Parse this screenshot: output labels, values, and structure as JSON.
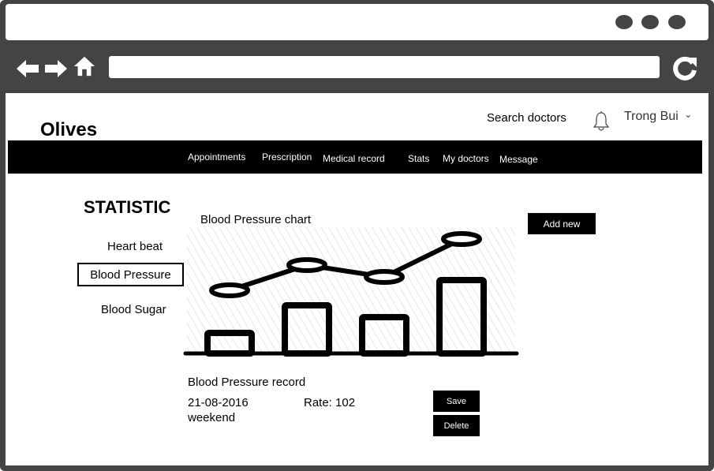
{
  "browser": {
    "window_controls": [
      "dot-icon",
      "dot-icon",
      "dot-icon"
    ],
    "nav_icons": [
      "back-arrow-icon",
      "forward-arrow-icon",
      "home-icon"
    ],
    "url_value": "",
    "reload_icon": "reload-icon"
  },
  "header": {
    "brand": "Olives",
    "search_label": "Search doctors",
    "bell_icon": "bell-icon",
    "user_name": "Trong Bui",
    "user_caret": "⌄"
  },
  "nav": {
    "items": [
      "Appointments",
      "Prescription",
      "Medical record",
      "Stats",
      "My doctors",
      "Message"
    ]
  },
  "sidebar": {
    "title": "STATISTIC",
    "items": [
      "Heart beat",
      "Blood Pressure",
      "Blood Sugar"
    ],
    "active": "Blood Pressure"
  },
  "chart": {
    "title": "Blood Pressure chart",
    "add_button": "Add new"
  },
  "chart_data": {
    "type": "bar",
    "title": "Blood Pressure chart",
    "categories": [
      "",
      "",
      "",
      ""
    ],
    "series": [
      {
        "values": [
          30,
          65,
          50,
          97
        ]
      },
      {
        "values": [
          80,
          112,
          97,
          145
        ]
      }
    ],
    "ylim": [
      0,
      160
    ],
    "grid": false
  },
  "record": {
    "title": "Blood Pressure record",
    "date": "21-08-2016",
    "label": "weekend",
    "rate": "Rate: 102",
    "save_button": "Save",
    "delete_button": "Delete"
  },
  "colors": {
    "frame": "#444444",
    "navbar": "#000000",
    "button": "#000000"
  }
}
